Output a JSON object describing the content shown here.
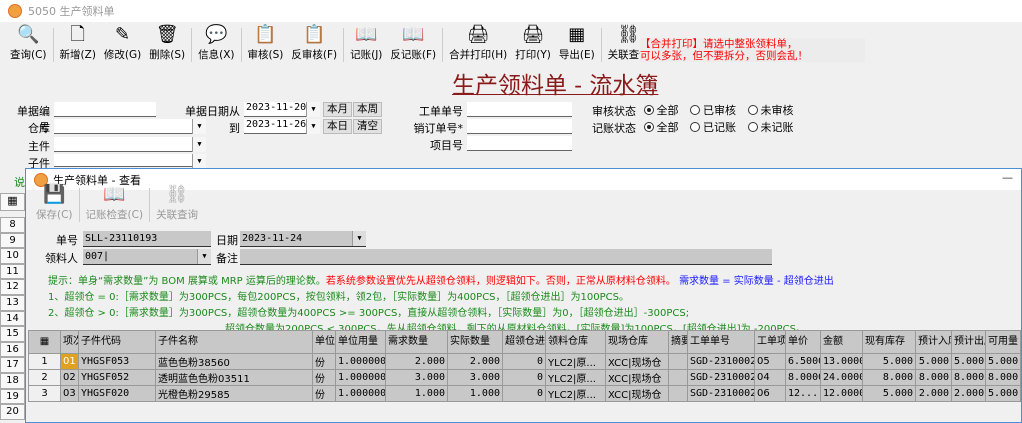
{
  "window": {
    "title": "5050 生产领料单"
  },
  "toolbar": [
    {
      "label": "查询(C)",
      "icon": "magnifier-icon",
      "glyph": "🔍"
    },
    {
      "label": "新增(Z)",
      "icon": "new-document-icon",
      "glyph": "🗋"
    },
    {
      "label": "修改(G)",
      "icon": "edit-pencil-icon",
      "glyph": "✎"
    },
    {
      "label": "删除(S)",
      "icon": "trash-icon",
      "glyph": "🗑"
    },
    {
      "label": "信息(X)",
      "icon": "message-icon",
      "glyph": "💬"
    },
    {
      "label": "审核(S)",
      "icon": "approve-clipboard-icon",
      "glyph": "📋"
    },
    {
      "label": "反审核(F)",
      "icon": "unapprove-clipboard-icon",
      "glyph": "📋"
    },
    {
      "label": "记账(J)",
      "icon": "ledger-book-icon",
      "glyph": "📖"
    },
    {
      "label": "反记账(F)",
      "icon": "open-book-icon",
      "glyph": "📖"
    },
    {
      "label": "合并打印(H)",
      "icon": "printer-icon",
      "glyph": "🖨"
    },
    {
      "label": "打印(Y)",
      "icon": "printer-icon",
      "glyph": "🖨"
    },
    {
      "label": "导出(E)",
      "icon": "excel-export-icon",
      "glyph": "▦"
    },
    {
      "label": "关联查询",
      "icon": "chain-link-icon",
      "glyph": "⛓"
    }
  ],
  "warning": {
    "line1": "【合并打印】请选中整张领料单，",
    "line2": "可以多张，但不要拆分，否则会乱！"
  },
  "page_title": "生产领料单 - 流水簿",
  "filters": {
    "doc_no_label": "单据编号",
    "doc_no": "",
    "warehouse_label": "仓库",
    "warehouse": "",
    "main_part_label": "主件",
    "main_part": "",
    "sub_part_label": "子件",
    "sub_part": "",
    "date_from_label": "单据日期从",
    "date_from": "2023-11-20",
    "date_to_label": "到",
    "date_to": "2023-11-26",
    "this_month": "本月",
    "this_week": "本周",
    "today": "本日",
    "clear": "清空",
    "work_order_label": "工单单号",
    "work_order": "",
    "sales_order_label": "销订单号*",
    "sales_order": "",
    "project_label": "项目号",
    "project": "",
    "audit_label": "审核状态",
    "audit_options": [
      "全部",
      "已审核",
      "未审核"
    ],
    "audit_selected": "全部",
    "post_label": "记账状态",
    "post_options": [
      "全部",
      "已记账",
      "未记账"
    ],
    "post_selected": "全部"
  },
  "bg_hint": "说",
  "row_numbers": [
    "8",
    "9",
    "10",
    "11",
    "12",
    "13",
    "14",
    "15",
    "16",
    "17",
    "18",
    "19",
    "20"
  ],
  "child": {
    "title": "生产领料单 - 查看",
    "toolbar": [
      {
        "label": "保存(C)",
        "icon": "save-disk-icon",
        "glyph": "💾"
      },
      {
        "label": "记账检查(C)",
        "icon": "ledger-book-icon",
        "glyph": "📖"
      },
      {
        "label": "关联查询",
        "icon": "chain-link-icon",
        "glyph": "⛓"
      }
    ],
    "doc_no_label": "单号",
    "doc_no": "SLL-23110193",
    "date_label": "日期",
    "date": "2023-11-24",
    "picker_label": "领料人",
    "picker": "007|",
    "remark_label": "备注",
    "remark": "",
    "hints": {
      "l1_green": "提示：单身“需求数量”为 BOM 展算或 MRP 运算后的理论数。",
      "l1_red": "若系统参数设置优先从超领仓领料，则逻辑如下。否则，正常从原材料仓领料。",
      "l1_blue": "需求数量 = 实际数量 - 超领仓进出",
      "l2": "1、超领仓 = 0:［需求数量］为300PCS，每包200PCS，按包领料，领2包，［实际数量］为400PCS，［超领仓进出］为100PCS。",
      "l3": "2、超领仓 > 0:［需求数量］为300PCS，超领仓数量为400PCS >= 300PCS，直接从超领仓领料，［实际数量］为0，［超领仓进出］-300PCS;",
      "l4": "超领仓数量为200PCS < 300PCS，先从超领仓领料，剩下的从原材料仓领料。[实际数量]为100PCS，[超领仓进出]为 -200PCS。"
    },
    "columns": [
      "项次",
      "子件代码",
      "子件名称",
      "单位",
      "单位用量",
      "需求数量",
      "实际数量",
      "超领仓进出",
      "领料仓库",
      "现场仓库",
      "摘要",
      "工单单号",
      "工单项次",
      "单价",
      "金额",
      "现有库存",
      "预计入库",
      "预计出库",
      "可用量"
    ],
    "rows": [
      [
        "1",
        "01",
        "YHGSF053",
        "蓝色色粉38560",
        "份",
        "1.000000",
        "2.000",
        "2.000",
        "0",
        "YLC2|原...",
        "XCC|现场仓",
        "",
        "SGD-23100021",
        "05",
        "6.5000",
        "13.0000",
        "5.000",
        "5.000",
        "5.000",
        "5.000"
      ],
      [
        "2",
        "02",
        "YHGSF052",
        "透明蓝色色粉03511",
        "份",
        "1.000000",
        "3.000",
        "3.000",
        "0",
        "YLC2|原...",
        "XCC|现场仓",
        "",
        "SGD-23100021",
        "04",
        "8.0000",
        "24.0000",
        "8.000",
        "8.000",
        "8.000",
        "8.000"
      ],
      [
        "3",
        "03",
        "YHGSF020",
        "光橙色粉29585",
        "份",
        "1.000000",
        "1.000",
        "1.000",
        "0",
        "YLC2|原...",
        "XCC|现场仓",
        "",
        "SGD-23100021",
        "06",
        "12....",
        "12.0000",
        "5.000",
        "2.000",
        "2.000",
        "5.000"
      ]
    ]
  }
}
